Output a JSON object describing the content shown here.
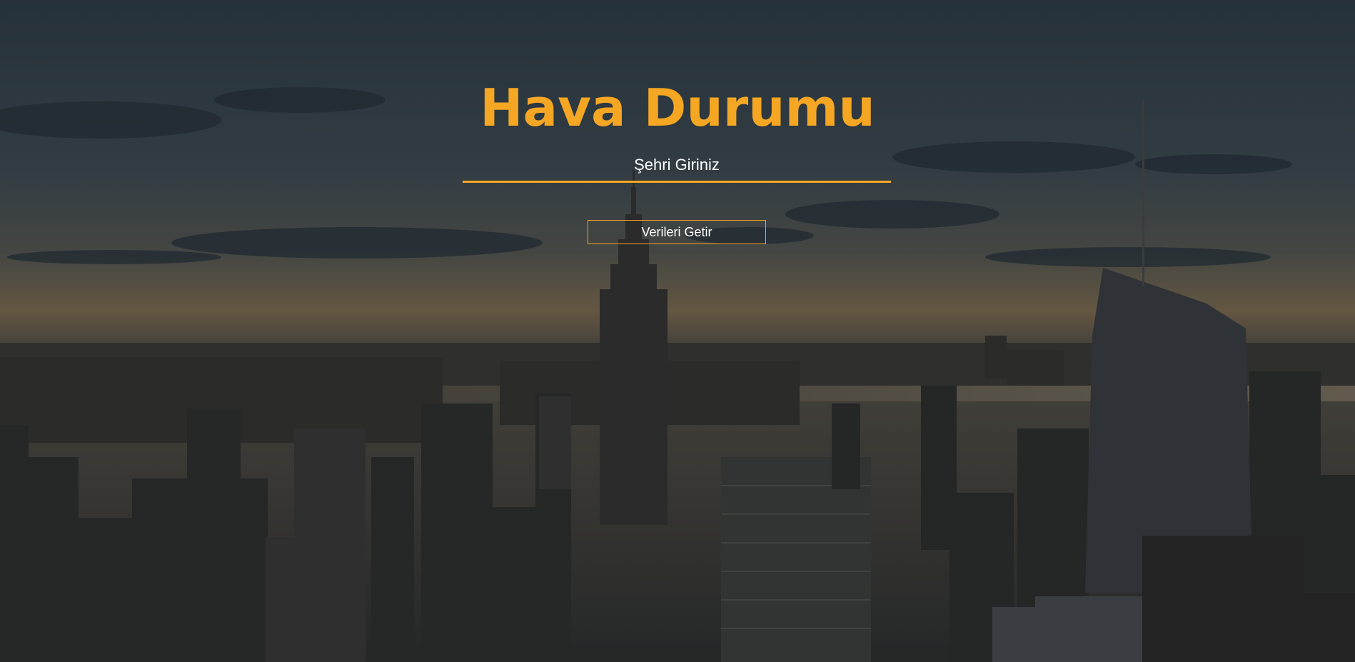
{
  "header": {
    "title": "Hava Durumu"
  },
  "search": {
    "placeholder": "Şehri Giriniz",
    "value": ""
  },
  "actions": {
    "fetch_label": "Verileri Getir"
  },
  "theme": {
    "accent": "#f5a623",
    "text": "#ffffff",
    "overlay": "#1e2328"
  }
}
